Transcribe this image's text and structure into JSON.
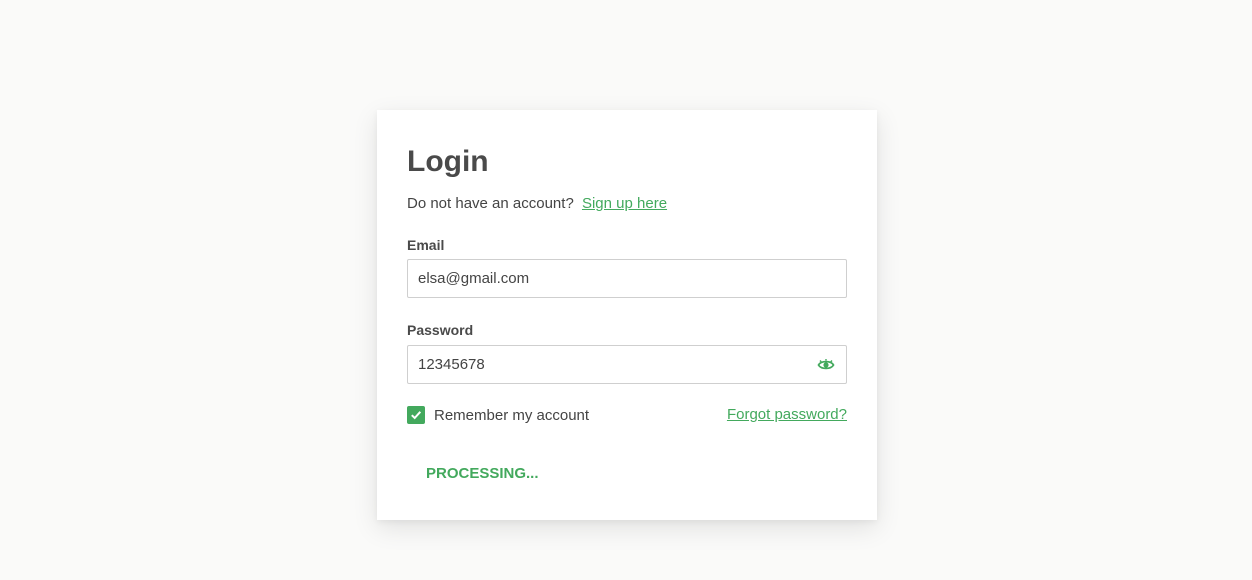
{
  "login": {
    "title": "Login",
    "signup_prompt": "Do not have an account?",
    "signup_link": "Sign up here",
    "email_label": "Email",
    "email_value": "elsa@gmail.com",
    "password_label": "Password",
    "password_value": "12345678",
    "password_toggle_icon": "eye-icon",
    "remember_label": "Remember my account",
    "remember_checked": true,
    "forgot_link": "Forgot password?",
    "submit_label": "PROCESSING..."
  },
  "colors": {
    "accent": "#43a95d",
    "background": "#fafaf9",
    "card": "#ffffff",
    "text": "#444444"
  }
}
